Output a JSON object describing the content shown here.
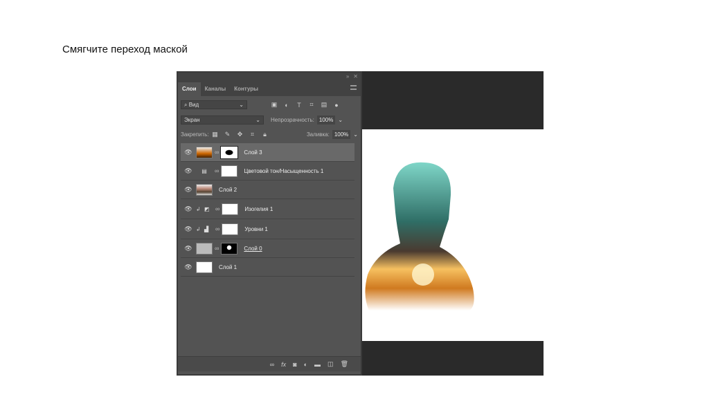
{
  "slide_title": "Смягчите переход маской",
  "panel": {
    "tabs": [
      "Слои",
      "Каналы",
      "Контуры"
    ],
    "filter": "Вид",
    "blend_mode": "Экран",
    "opacity_label": "Непрозрачность:",
    "opacity": "100%",
    "lock_label": "Закрепить:",
    "fill_label": "Заливка:",
    "fill": "100%",
    "layers": [
      {
        "name": "Слой 3",
        "selected": true
      },
      {
        "name": "Цветовой тон/Насыщенность 1"
      },
      {
        "name": "Слой 2"
      },
      {
        "name": "Изогелия 1"
      },
      {
        "name": "Уровни 1"
      },
      {
        "name": "Слой 0"
      },
      {
        "name": "Слой 1"
      }
    ]
  },
  "colors": {
    "panel": "#535353",
    "canvas": "#2a2a2a"
  }
}
